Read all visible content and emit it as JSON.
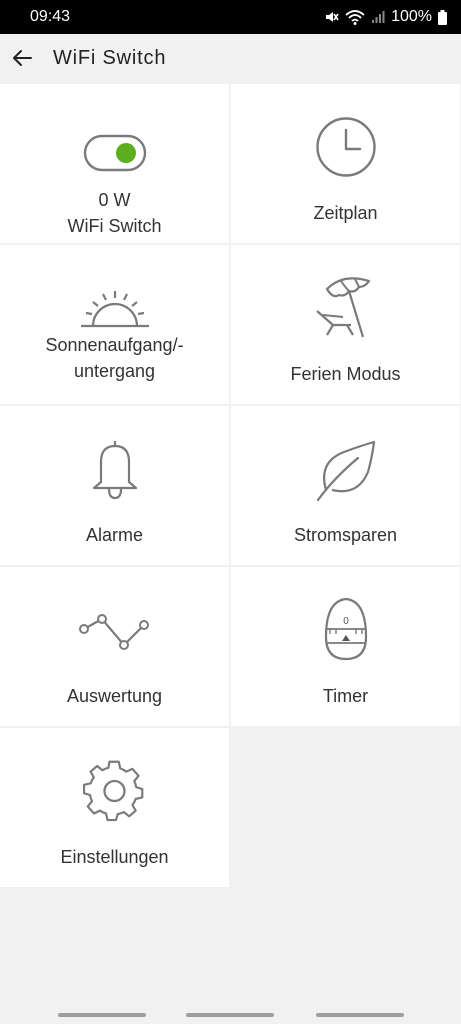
{
  "status_bar": {
    "time": "09:43",
    "battery": "100%"
  },
  "header": {
    "title": "WiFi Switch",
    "back_icon": "arrow-left-icon"
  },
  "tiles": {
    "switch": {
      "power": "0 W",
      "label": "WiFi Switch",
      "icon": "toggle-on-icon",
      "accent": "#5dae1e"
    },
    "schedule": {
      "label": "Zeitplan",
      "icon": "clock-icon"
    },
    "sunrise": {
      "label_line1": "Sonnenaufgang/-",
      "label_line2": "untergang",
      "icon": "sunrise-icon"
    },
    "holiday": {
      "label": "Ferien Modus",
      "icon": "beach-umbrella-icon"
    },
    "alarms": {
      "label": "Alarme",
      "icon": "bell-icon"
    },
    "energy": {
      "label": "Stromsparen",
      "icon": "leaf-icon"
    },
    "analysis": {
      "label": "Auswertung",
      "icon": "line-graph-icon"
    },
    "timer": {
      "label": "Timer",
      "icon": "egg-timer-icon",
      "dial_value": "0"
    },
    "settings": {
      "label": "Einstellungen",
      "icon": "gear-icon"
    }
  }
}
